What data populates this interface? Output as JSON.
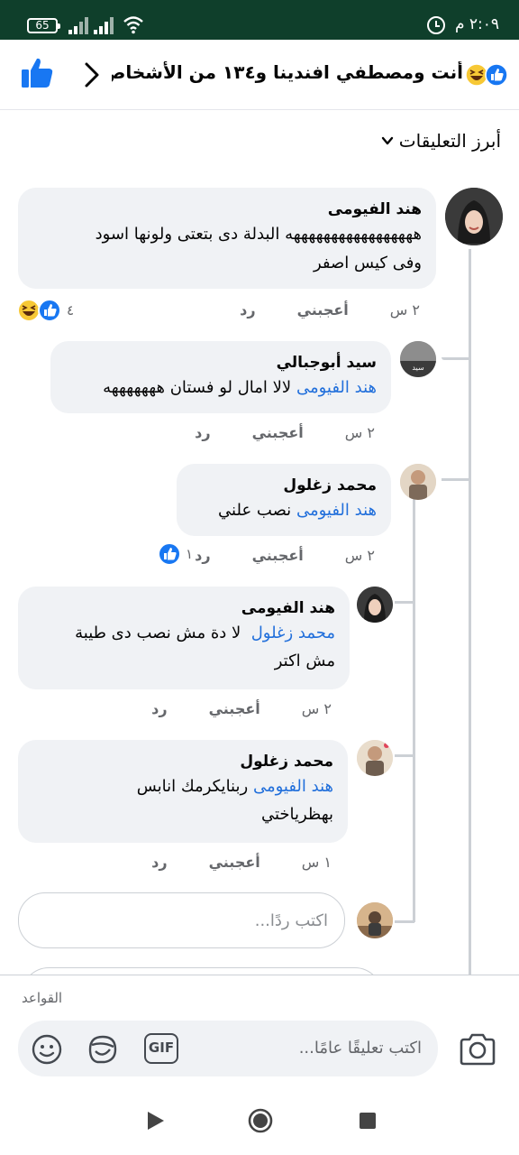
{
  "status_bar": {
    "battery": "65",
    "time": "٢:٠٩ م"
  },
  "header": {
    "title": "أنت ومصطفي افندينا و١٣٤ من الأشخاص ا...",
    "reaction_icons": [
      "like-icon",
      "haha-icon"
    ]
  },
  "sort": {
    "label": "أبرز التعليقات"
  },
  "comments": [
    {
      "author": "هند الفيومى",
      "text_line1": "هههههههههههههههههه البدلة دى بتعتى ولونها اسود",
      "text_line2": "وفى كيس اصفر",
      "time": "٢ س",
      "like_label": "أعجبني",
      "reply_label": "رد",
      "reaction_count": "٤"
    },
    {
      "author": "سيد أبوجبالي",
      "mention": "هند الفيومى",
      "text": "لالا امال لو فستان هههههههه",
      "time": "٢ س",
      "like_label": "أعجبني",
      "reply_label": "رد"
    },
    {
      "author": "محمد زغلول",
      "mention": "هند الفيومى",
      "text": "نصب علني",
      "time": "٢ س",
      "like_label": "أعجبني",
      "reply_label": "رد",
      "reaction_count": "١"
    },
    {
      "author": "هند الفيومى",
      "mention": "محمد زغلول",
      "text_line1": "لا دة مش نصب دى طيبة",
      "text_line2": "مش اكتر",
      "time": "٢ س",
      "like_label": "أعجبني",
      "reply_label": "رد"
    },
    {
      "author": "محمد زغلول",
      "mention": "هند الفيومى",
      "text_line1": "ربنايكرمك انابس",
      "text_line2": "بهظرياختي",
      "time": "١ س",
      "like_label": "أعجبني",
      "reply_label": "رد"
    }
  ],
  "reply_input": {
    "placeholder": "اكتب ردًا..."
  },
  "composer": {
    "rules_label": "القواعد",
    "placeholder": "اكتب تعليقًا عامًا...",
    "gif_label": "GIF"
  },
  "colors": {
    "accent": "#1877f2",
    "mention": "#216fdb",
    "status_bar": "#0f3f2b"
  }
}
